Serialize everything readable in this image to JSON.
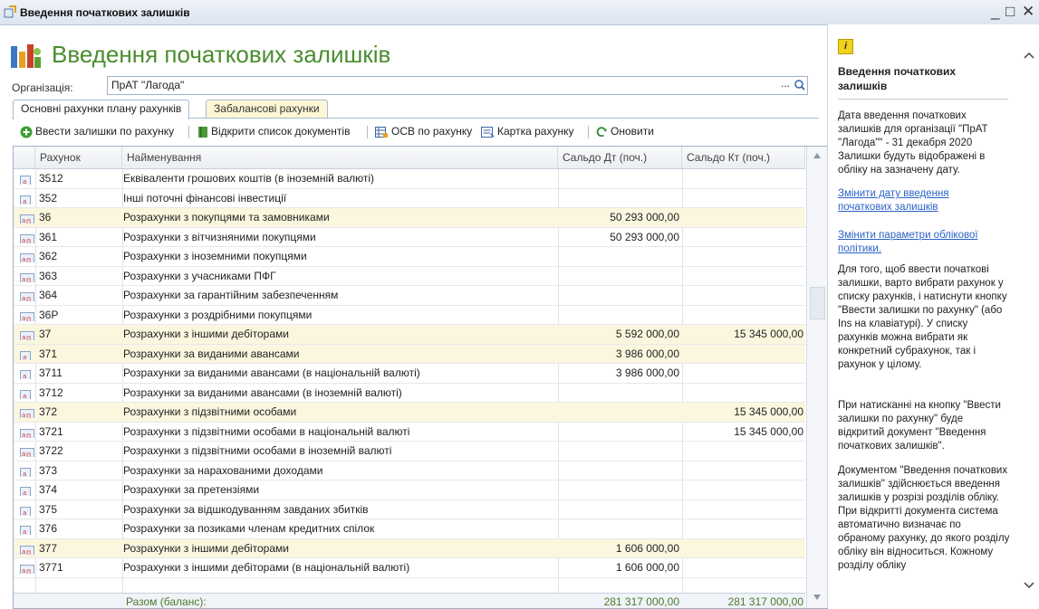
{
  "window": {
    "title": "Введення початкових залишків",
    "controls": [
      "_",
      "□",
      "✕"
    ]
  },
  "heading": "Введення початкових залишків",
  "organization": {
    "label": "Організація:",
    "value": "ПрАТ \"Лагода\"",
    "dots": "..."
  },
  "tabs": [
    {
      "label": "Основні рахунки плану рахунків",
      "active": true
    },
    {
      "label": "Забалансові рахунки",
      "active": false
    }
  ],
  "toolbar": {
    "enter_balances": "Ввести залишки по рахунку",
    "open_docs": "Відкрити список документів",
    "osv": "ОСВ по рахунку",
    "card": "Картка рахунку",
    "refresh": "Оновити"
  },
  "table": {
    "columns": [
      "Рахунок",
      "Найменування",
      "Сальдо Дт (поч.)",
      "Сальдо Кт (поч.)"
    ],
    "rows": [
      {
        "account": "3512",
        "name": "Еквіваленти грошових коштів (в іноземній валюті)",
        "dt": "",
        "kt": "",
        "group": false,
        "hl": false
      },
      {
        "account": "352",
        "name": "Інші поточні фінансові інвестиції",
        "dt": "",
        "kt": "",
        "group": false,
        "hl": false
      },
      {
        "account": "36",
        "name": "Розрахунки з покупцями та замовниками",
        "dt": "50 293 000,00",
        "kt": "",
        "group": true,
        "hl": true
      },
      {
        "account": "361",
        "name": "Розрахунки з вітчизняними покупцями",
        "dt": "50 293 000,00",
        "kt": "",
        "group": true,
        "hl": false
      },
      {
        "account": "362",
        "name": "Розрахунки з іноземними покупцями",
        "dt": "",
        "kt": "",
        "group": true,
        "hl": false
      },
      {
        "account": "363",
        "name": "Розрахунки з учасниками ПФГ",
        "dt": "",
        "kt": "",
        "group": true,
        "hl": false
      },
      {
        "account": "364",
        "name": "Розрахунки за гарантійним забезпеченням",
        "dt": "",
        "kt": "",
        "group": true,
        "hl": false
      },
      {
        "account": "36Р",
        "name": "Розрахунки з роздрібними покупцями",
        "dt": "",
        "kt": "",
        "group": true,
        "hl": false
      },
      {
        "account": "37",
        "name": "Розрахунки з іншими дебіторами",
        "dt": "5 592 000,00",
        "kt": "15 345 000,00",
        "group": true,
        "hl": true
      },
      {
        "account": "371",
        "name": "Розрахунки за виданими авансами",
        "dt": "3 986 000,00",
        "kt": "",
        "group": false,
        "hl": true
      },
      {
        "account": "3711",
        "name": "Розрахунки за виданими авансами (в національній валюті)",
        "dt": "3 986 000,00",
        "kt": "",
        "group": false,
        "hl": false
      },
      {
        "account": "3712",
        "name": "Розрахунки за виданими авансами (в іноземній валюті)",
        "dt": "",
        "kt": "",
        "group": false,
        "hl": false
      },
      {
        "account": "372",
        "name": "Розрахунки з підзвітними особами",
        "dt": "",
        "kt": "15 345 000,00",
        "group": true,
        "hl": true
      },
      {
        "account": "3721",
        "name": "Розрахунки з підзвітними особами в національній валюті",
        "dt": "",
        "kt": "15 345 000,00",
        "group": true,
        "hl": false
      },
      {
        "account": "3722",
        "name": "Розрахунки з підзвітними особами в іноземній валюті",
        "dt": "",
        "kt": "",
        "group": true,
        "hl": false
      },
      {
        "account": "373",
        "name": "Розрахунки за нарахованими доходами",
        "dt": "",
        "kt": "",
        "group": false,
        "hl": false
      },
      {
        "account": "374",
        "name": "Розрахунки за претензіями",
        "dt": "",
        "kt": "",
        "group": false,
        "hl": false
      },
      {
        "account": "375",
        "name": "Розрахунки за відшкодуванням завданих збитків",
        "dt": "",
        "kt": "",
        "group": false,
        "hl": false
      },
      {
        "account": "376",
        "name": "Розрахунки за позиками членам кредитних спілок",
        "dt": "",
        "kt": "",
        "group": false,
        "hl": false
      },
      {
        "account": "377",
        "name": "Розрахунки з іншими дебіторами",
        "dt": "1 606 000,00",
        "kt": "",
        "group": true,
        "hl": true
      },
      {
        "account": "3771",
        "name": "Розрахунки з іншими дебіторами (в національній валюті)",
        "dt": "1 606 000,00",
        "kt": "",
        "group": true,
        "hl": false
      }
    ],
    "footer": {
      "label": "Разом (баланс):",
      "dt": "281 317 000,00",
      "kt": "281 317 000,00"
    }
  },
  "panel": {
    "title": "Введення початкових залишків",
    "intro": "Дата введення початкових залишків для організації \"ПрАТ \"Лагода\"\" - 31 декабря 2020 Залишки будуть відображені в обліку на зазначену дату.",
    "link_date": "Змінити дату введення початкових залишків",
    "link_policy": "Змінити параметри облікової політики.",
    "para1": "Для того, щоб ввести початкові залишки, варто вибрати рахунок у списку рахунків, і натиснути кнопку \"Ввести залишки по рахунку\" (або Ins на клавіатурі). У списку рахунків можна вибрати як конкретний субрахунок, так і рахунок у цілому.",
    "para2": "При натисканні на кнопку \"Ввести залишки по рахунку\" буде відкритий документ \"Введення початкових залишків\".",
    "para3": "Документом \"Введення початкових залишків\" здійснюється введення залишків у розрізі розділів обліку. При відкритті документа система автоматично визначає по обраному рахунку, до якого розділу обліку він відноситься. Кожному розділу обліку"
  }
}
